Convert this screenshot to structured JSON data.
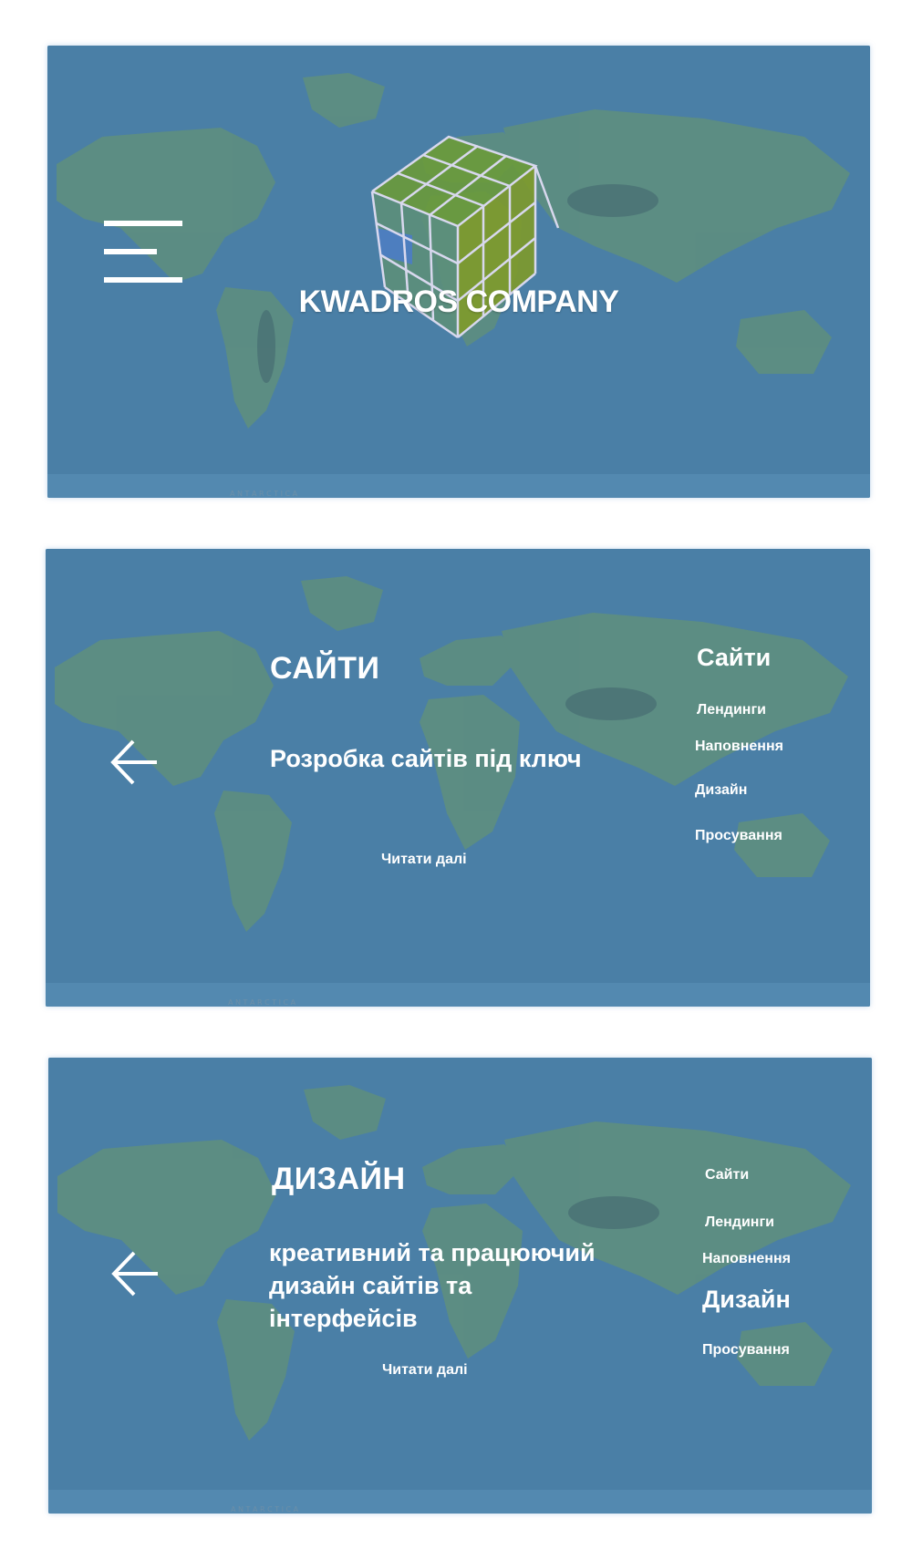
{
  "hero": {
    "brand": "KWADROS COMPANY"
  },
  "slides": [
    {
      "heading": "САЙТИ",
      "subtitle": "Розробка сайтів під ключ",
      "read_more": "Читати далі",
      "menu": [
        "Сайти",
        "Лендинги",
        "Наповнення",
        "Дизайн",
        "Просування"
      ],
      "active_index": 0
    },
    {
      "heading": "ДИЗАЙН",
      "subtitle": "креативний та працюючий дизайн сайтів та інтерфейсів",
      "read_more": "Читати далі",
      "menu": [
        "Сайти",
        "Лендинги",
        "Наповнення",
        "Дизайн",
        "Просування"
      ],
      "active_index": 3
    }
  ],
  "map_labels": {
    "antarctica": "A N T A R C T I C A"
  },
  "colors": {
    "ocean": "#4a7fa6",
    "land": "#5f8f7d",
    "text": "#ffffff"
  }
}
